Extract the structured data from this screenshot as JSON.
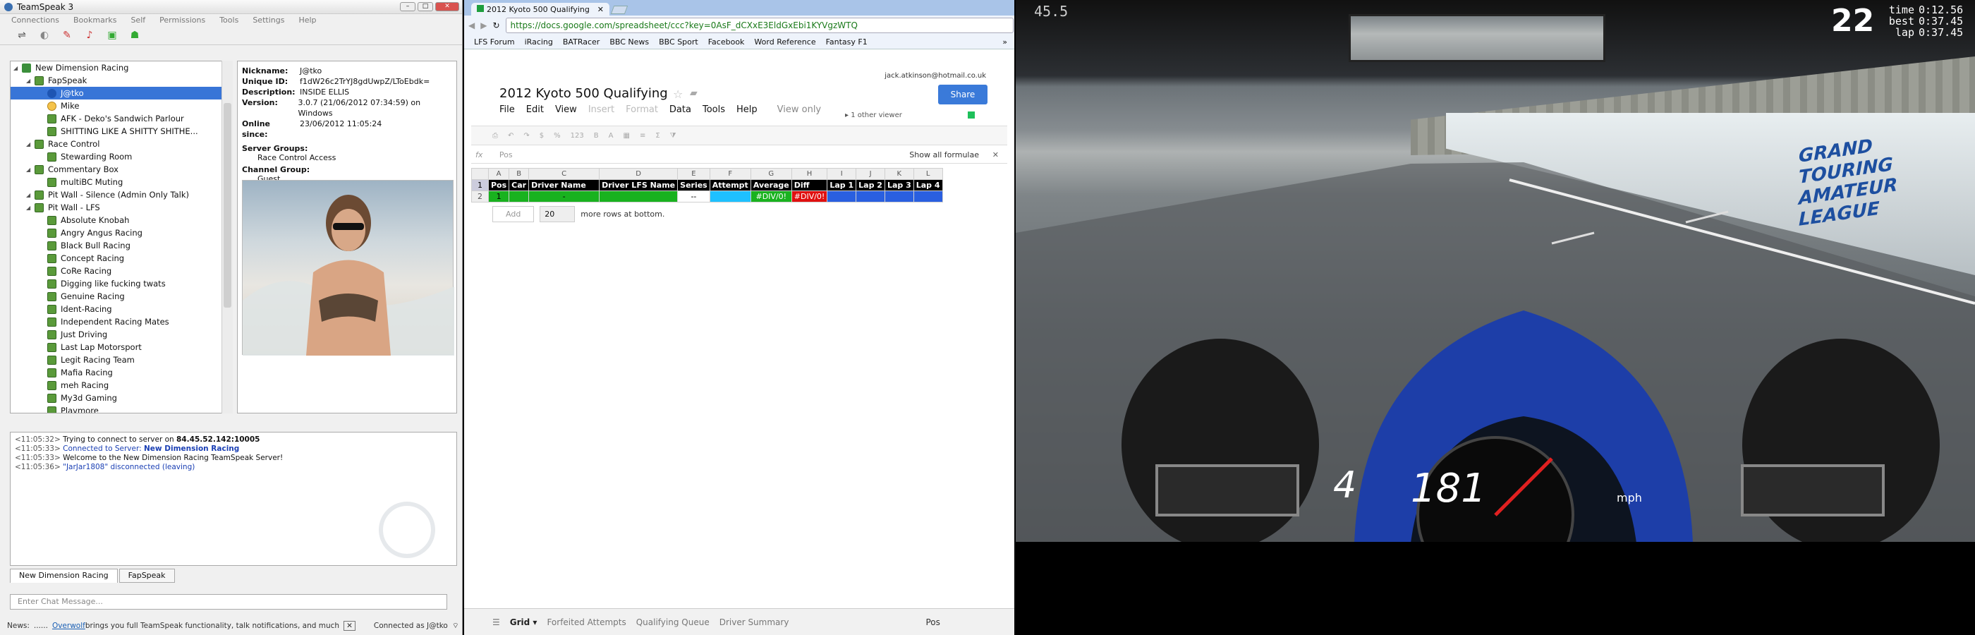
{
  "teamspeak": {
    "title": "TeamSpeak 3",
    "menu": [
      "Connections",
      "Bookmarks",
      "Self",
      "Permissions",
      "Tools",
      "Settings",
      "Help"
    ],
    "tree": [
      {
        "label": "New Dimension Racing",
        "type": "server",
        "indent": 0
      },
      {
        "label": "FapSpeak",
        "type": "chan",
        "indent": 1,
        "lock": true
      },
      {
        "label": "J@tko",
        "type": "user",
        "indent": 2,
        "selected": true
      },
      {
        "label": "Mike",
        "type": "user2",
        "indent": 2
      },
      {
        "label": "AFK - Deko's Sandwich Parlour",
        "type": "chan",
        "indent": 2,
        "lock": true
      },
      {
        "label": "SHITTING LIKE A SHITTY SHITHE...",
        "type": "chan",
        "indent": 2,
        "lock": true
      },
      {
        "label": "Race Control",
        "type": "chan",
        "indent": 1
      },
      {
        "label": "Stewarding Room",
        "type": "chan",
        "indent": 2,
        "lock": true
      },
      {
        "label": "Commentary Box",
        "type": "chan",
        "indent": 1,
        "lock": true
      },
      {
        "label": "multiBC Muting",
        "type": "chan",
        "indent": 2,
        "lock": true
      },
      {
        "label": "Pit Wall - Silence (Admin Only Talk)",
        "type": "chan",
        "indent": 1,
        "lock": true
      },
      {
        "label": "Pit Wall - LFS",
        "type": "chan",
        "indent": 1
      },
      {
        "label": "Absolute Knobah",
        "type": "chan",
        "indent": 2
      },
      {
        "label": "Angry Angus Racing",
        "type": "chan",
        "indent": 2
      },
      {
        "label": "Black Bull Racing",
        "type": "chan",
        "indent": 2
      },
      {
        "label": "Concept Racing",
        "type": "chan",
        "indent": 2
      },
      {
        "label": "CoRe Racing",
        "type": "chan",
        "indent": 2,
        "lock": true
      },
      {
        "label": "Digging like fucking twats",
        "type": "chan",
        "indent": 2,
        "lock": true
      },
      {
        "label": "Genuine Racing",
        "type": "chan",
        "indent": 2,
        "lock": true
      },
      {
        "label": "Ident-Racing",
        "type": "chan",
        "indent": 2
      },
      {
        "label": "Independent Racing Mates",
        "type": "chan",
        "indent": 2
      },
      {
        "label": "Just Driving",
        "type": "chan",
        "indent": 2
      },
      {
        "label": "Last Lap Motorsport",
        "type": "chan",
        "indent": 2
      },
      {
        "label": "Legit Racing Team",
        "type": "chan",
        "indent": 2,
        "lock": true
      },
      {
        "label": "Mafia Racing",
        "type": "chan",
        "indent": 2
      },
      {
        "label": "meh Racing",
        "type": "chan",
        "indent": 2,
        "lock": true
      },
      {
        "label": "My3d Gaming",
        "type": "chan",
        "indent": 2,
        "lock": true
      },
      {
        "label": "Playmore",
        "type": "chan",
        "indent": 2
      }
    ],
    "info": {
      "nickname_label": "Nickname:",
      "nickname": "J@tko",
      "uid_label": "Unique ID:",
      "uid": "f1dW26c2TrYJ8gdUwpZ/LToEbdk=",
      "desc_label": "Description:",
      "desc": "INSIDE ELLIS",
      "version_label": "Version:",
      "version": "3.0.7 (21/06/2012 07:34:59) on Windows",
      "online_label": "Online since:",
      "online": "23/06/2012 11:05:24",
      "server_groups_label": "Server Groups:",
      "server_groups": "Race Control Access",
      "channel_group_label": "Channel Group:",
      "channel_group": "Guest"
    },
    "log": [
      {
        "time": "<11:05:32>",
        "text": "Trying to connect to server on ",
        "bold": "84.45.52.142:10005",
        "color": "#111"
      },
      {
        "time": "<11:05:33>",
        "text": "Connected to Server: ",
        "bold": "New Dimension Racing",
        "color": "#1a3fb4"
      },
      {
        "time": "<11:05:33>",
        "text": "Welcome to the New Dimension Racing TeamSpeak Server!",
        "bold": "",
        "color": "#111"
      },
      {
        "time": "<11:05:36>",
        "text": "\"JarJar1808\" disconnected (leaving)",
        "bold": "",
        "color": "#1a3fb4"
      }
    ],
    "tabs": [
      "New Dimension Racing",
      "FapSpeak"
    ],
    "chat_placeholder": "Enter Chat Message...",
    "status": {
      "news": "News:",
      "dots": "......",
      "link": "Overwolf",
      "msg": " brings you full TeamSpeak functionality, talk notifications, and much",
      "connected": "Connected as J@tko"
    }
  },
  "chrome": {
    "tab_title": "2012 Kyoto 500 Qualifying",
    "url": "https://docs.google.com/spreadsheet/ccc?key=0AsF_dCXxE3EldGxEbi1KYVgzWTQ",
    "bookmarks": [
      "LFS Forum",
      "iRacing",
      "BATRacer",
      "BBC News",
      "BBC Sport",
      "Facebook",
      "Word Reference",
      "Fantasy F1"
    ]
  },
  "sheet": {
    "title": "2012 Kyoto 500 Qualifying",
    "account": "jack.atkinson@hotmail.co.uk",
    "share": "Share",
    "menus": [
      "File",
      "Edit",
      "View",
      "Insert",
      "Format",
      "Data",
      "Tools",
      "Help"
    ],
    "menus_dim": [
      false,
      false,
      false,
      true,
      true,
      false,
      false,
      false
    ],
    "view_only": "View only",
    "other_viewer": "1 other viewer",
    "fx_label": "fx",
    "fx_value": "Pos",
    "show_formulae": "Show all formulae",
    "col_letters": [
      "A",
      "B",
      "C",
      "D",
      "E",
      "F",
      "G",
      "H",
      "I",
      "J",
      "K",
      "L"
    ],
    "header_row": [
      "Pos",
      "Car",
      "Driver Name",
      "Driver LFS Name",
      "Series",
      "Attempt",
      "Average",
      "Diff",
      "Lap 1",
      "Lap 2",
      "Lap 3",
      "Lap 4"
    ],
    "row2": [
      "1",
      "",
      "-",
      "",
      "--",
      "",
      "#DIV/0!",
      "#DIV/0!",
      "",
      "",
      "",
      ""
    ],
    "add_label": "Add",
    "add_rows": "20",
    "more_rows": "more rows at bottom.",
    "sheets": [
      "Grid",
      "Forfeited Attempts",
      "Qualifying Queue",
      "Driver Summary"
    ],
    "active_cell": "Pos"
  },
  "lfs": {
    "fps": "45.5",
    "position": "22",
    "time_label": "time",
    "time": "0:12.56",
    "best_label": "best",
    "best": "0:37.45",
    "lap_label": "lap",
    "lap": "0:37.45",
    "gear": "4",
    "speed": "181",
    "unit": "mph",
    "wall_text": "GRAND TOURING AMATEUR LEAGUE"
  }
}
